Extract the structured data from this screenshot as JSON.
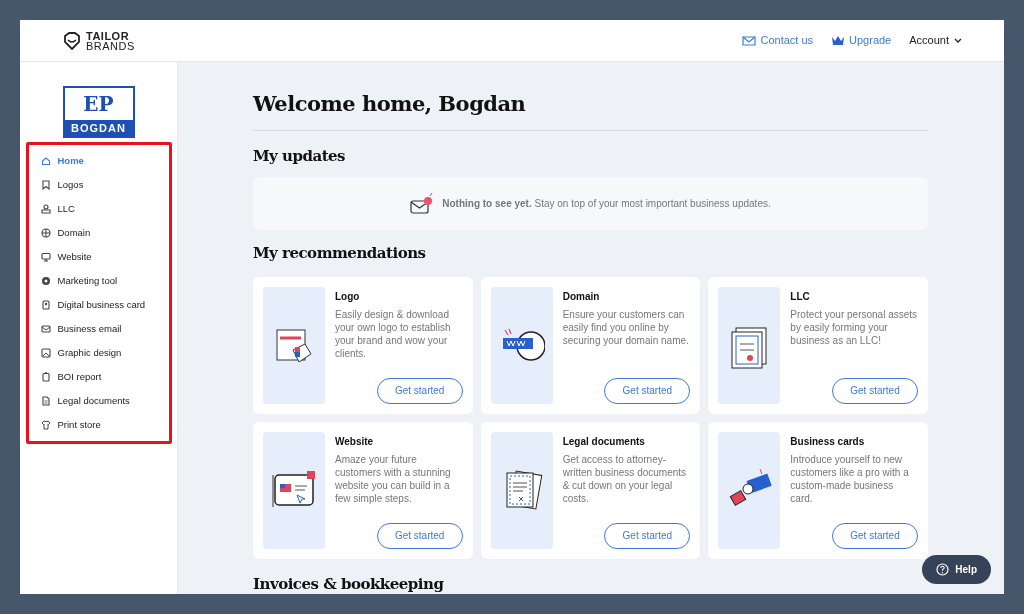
{
  "header": {
    "logo_lines": [
      "TAILOR",
      "BRANDS"
    ],
    "links": [
      {
        "label": "Contact us",
        "kind": "contact"
      },
      {
        "label": "Upgrade",
        "kind": "upgrade"
      }
    ],
    "account": {
      "label": "Account"
    }
  },
  "sidebar": {
    "brand_logo": {
      "initials": "EP",
      "name": "BOGDAN"
    },
    "highlighted": true,
    "items": [
      {
        "label": "Home",
        "kind": "home",
        "selected": true
      },
      {
        "label": "Logos",
        "kind": "bookmark",
        "selected": false
      },
      {
        "label": "LLC",
        "kind": "stamp",
        "selected": false
      },
      {
        "label": "Domain",
        "kind": "globe",
        "selected": false
      },
      {
        "label": "Website",
        "kind": "monitor",
        "selected": false
      },
      {
        "label": "Marketing tool",
        "kind": "dial",
        "selected": false
      },
      {
        "label": "Digital business card",
        "kind": "idcard",
        "selected": false
      },
      {
        "label": "Business email",
        "kind": "mail",
        "selected": false
      },
      {
        "label": "Graphic design",
        "kind": "image",
        "selected": false
      },
      {
        "label": "BOI report",
        "kind": "clipboard",
        "selected": false
      },
      {
        "label": "Legal documents",
        "kind": "doc",
        "selected": false
      },
      {
        "label": "Print store",
        "kind": "shirt",
        "selected": false
      }
    ]
  },
  "main": {
    "title": "Welcome home, Bogdan",
    "updates": {
      "heading": "My updates",
      "message": "**Nothing to see yet.** Stay on top of your most important business updates."
    },
    "recommendations": {
      "heading": "My recommendations",
      "cards": [
        {
          "title": "Logo",
          "description": "Easily design & download your own logo to establish your brand and wow your clients.",
          "button": "Get started",
          "kind": "logo"
        },
        {
          "title": "Domain",
          "description": "Ensure your customers can easily find you online by securing your domain name.",
          "button": "Get started",
          "kind": "domain"
        },
        {
          "title": "LLC",
          "description": "Protect your personal assets by easily forming your business as an LLC!",
          "button": "Get started",
          "kind": "llc"
        },
        {
          "title": "Website",
          "description": "Amaze your future customers with a stunning website you can build in a few simple steps.",
          "button": "Get started",
          "kind": "website"
        },
        {
          "title": "Legal documents",
          "description": "Get access to attorney-written business documents & cut down on your legal costs.",
          "button": "Get started",
          "kind": "legal"
        },
        {
          "title": "Business cards",
          "description": "Introduce yourself to new customers like a pro with a custom-made business card.",
          "button": "Get started",
          "kind": "cards"
        }
      ]
    },
    "next_heading": "Invoices & bookkeeping"
  },
  "help_button": {
    "label": "Help"
  }
}
